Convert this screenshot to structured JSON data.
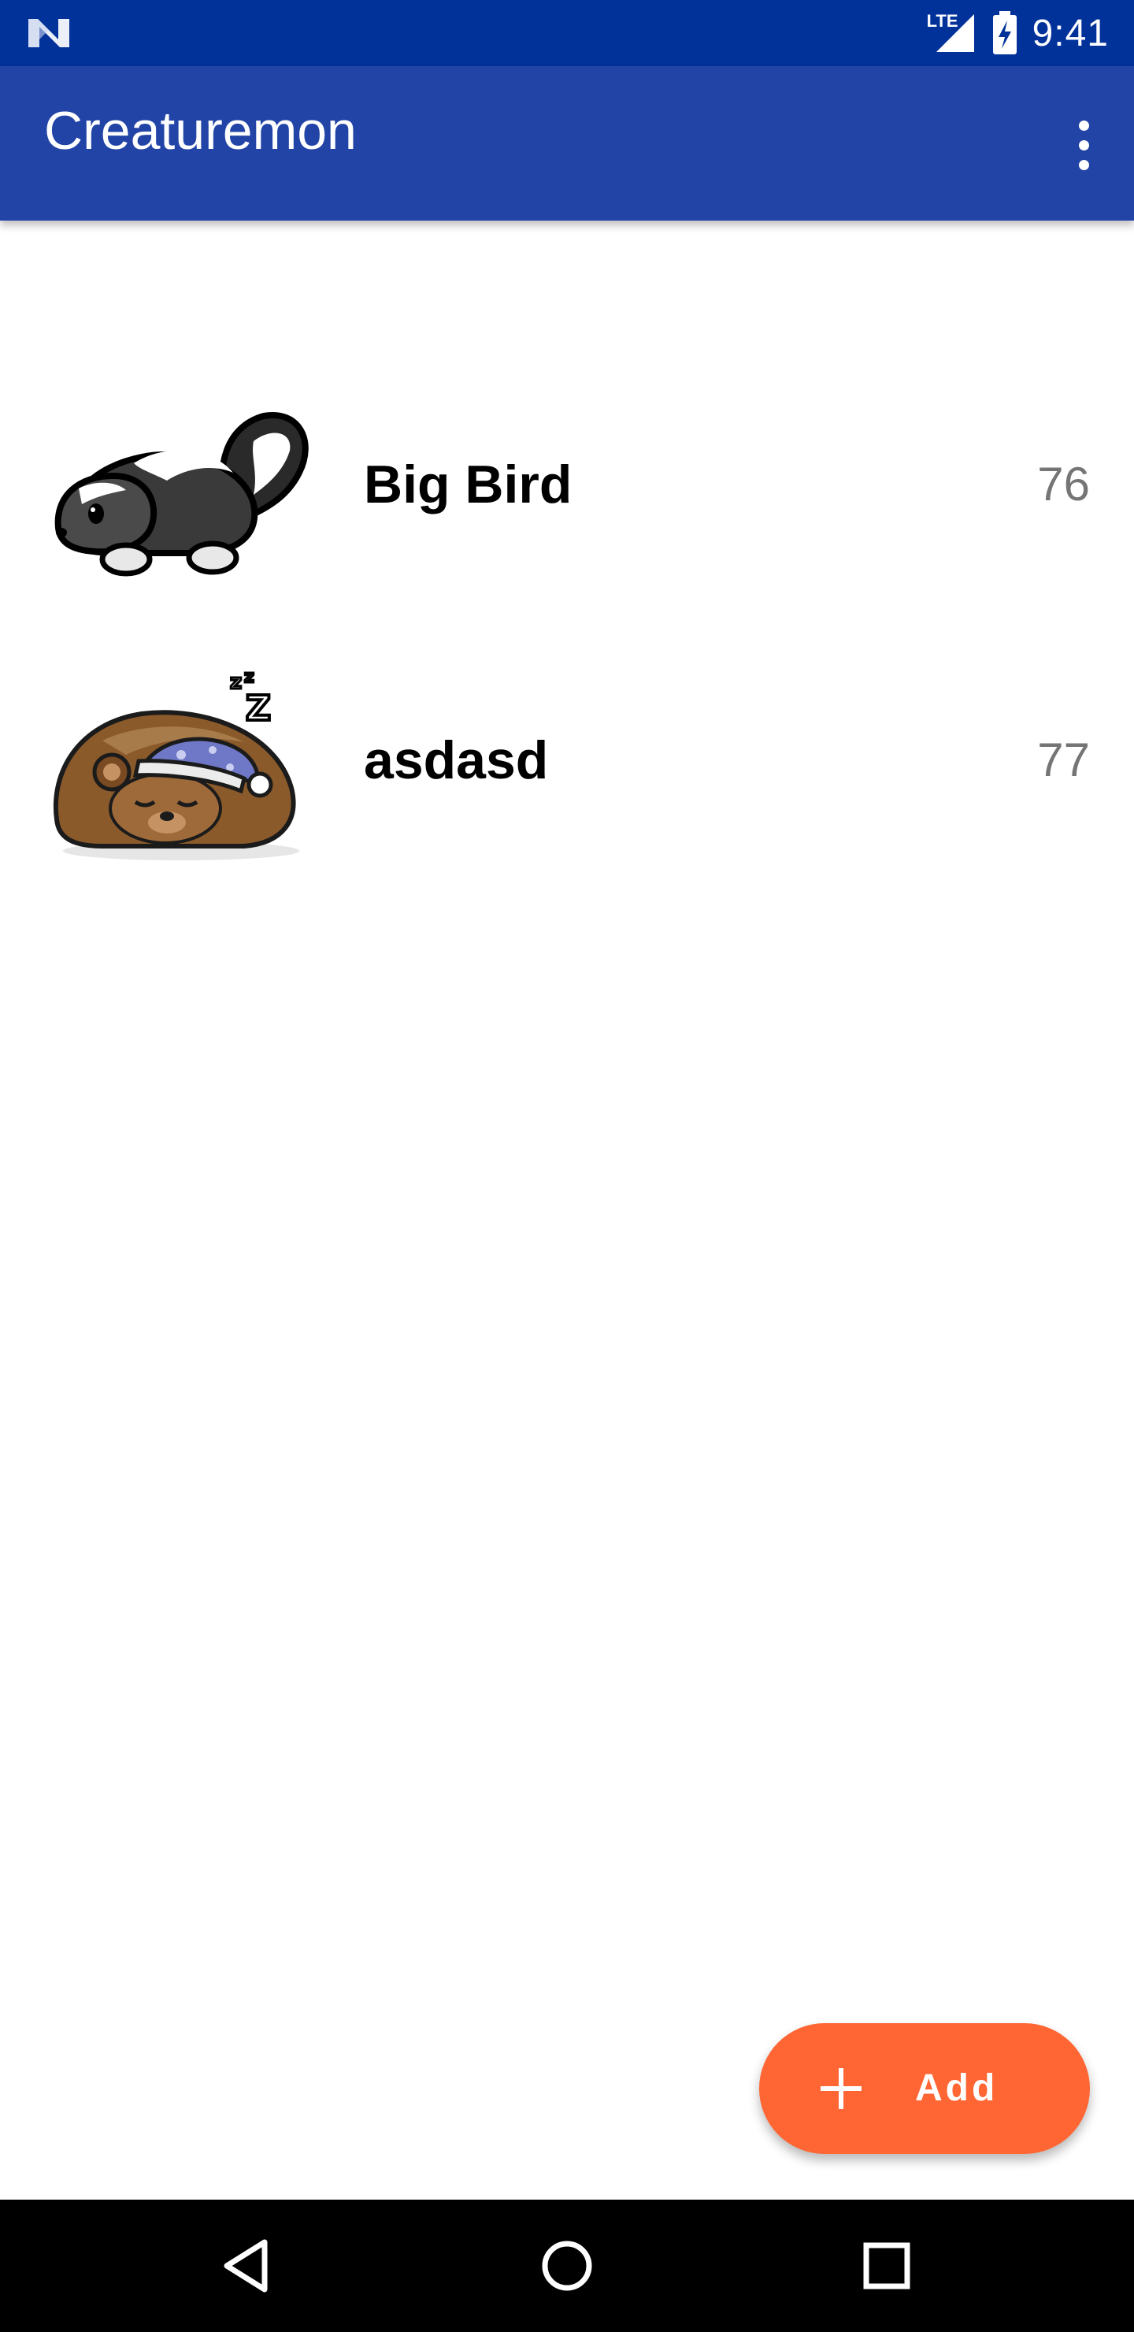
{
  "status_bar": {
    "time": "9:41",
    "network_label": "LTE",
    "left_icon": "n-notification-icon",
    "background": "#00329A"
  },
  "app_bar": {
    "title": "Creaturemon",
    "background": "#2244A6",
    "overflow_icon": "more-vert-icon"
  },
  "creatures": [
    {
      "name": "Big Bird",
      "value": "76",
      "image": "skunk-illustration"
    },
    {
      "name": "asdasd",
      "value": "77",
      "image": "sleeping-bear-illustration"
    }
  ],
  "fab": {
    "label": "Add",
    "icon": "plus-icon",
    "color": "#FF6633"
  },
  "nav_bar": {
    "back_icon": "back-triangle-icon",
    "home_icon": "home-circle-icon",
    "recents_icon": "recents-square-icon"
  }
}
